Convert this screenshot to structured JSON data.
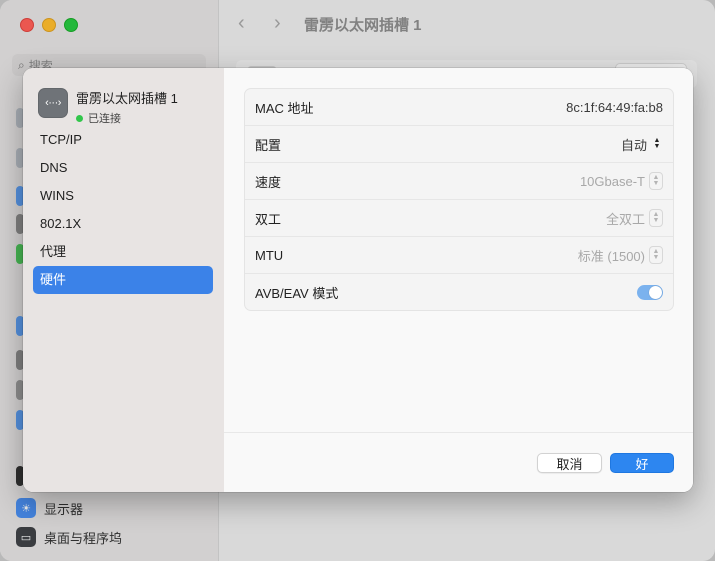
{
  "background": {
    "search_placeholder": "搜索",
    "title": "雷雳以太网插槽 1",
    "sidebar_items": [
      "显示器",
      "桌面与程序坞"
    ]
  },
  "sheet": {
    "interface_name": "雷雳以太网插槽 1",
    "interface_status": "已连接",
    "interface_icon_glyph": "‹···›",
    "status_color": "#32c64b",
    "nav_items": [
      "TCP/IP",
      "DNS",
      "WINS",
      "802.1X",
      "代理",
      "硬件"
    ],
    "selected_nav": "硬件",
    "rows": {
      "mac": {
        "label": "MAC 地址",
        "value": "8c:1f:64:49:fa:b8"
      },
      "config": {
        "label": "配置",
        "value": "自动"
      },
      "speed": {
        "label": "速度",
        "value": "10Gbase-T"
      },
      "duplex": {
        "label": "双工",
        "value": "全双工"
      },
      "mtu": {
        "label": "MTU",
        "value": "标准 (1500)"
      },
      "avb": {
        "label": "AVB/EAV 模式",
        "enabled": true
      }
    },
    "cancel_label": "取消",
    "ok_label": "好",
    "accent_color": "#2d86f0"
  }
}
